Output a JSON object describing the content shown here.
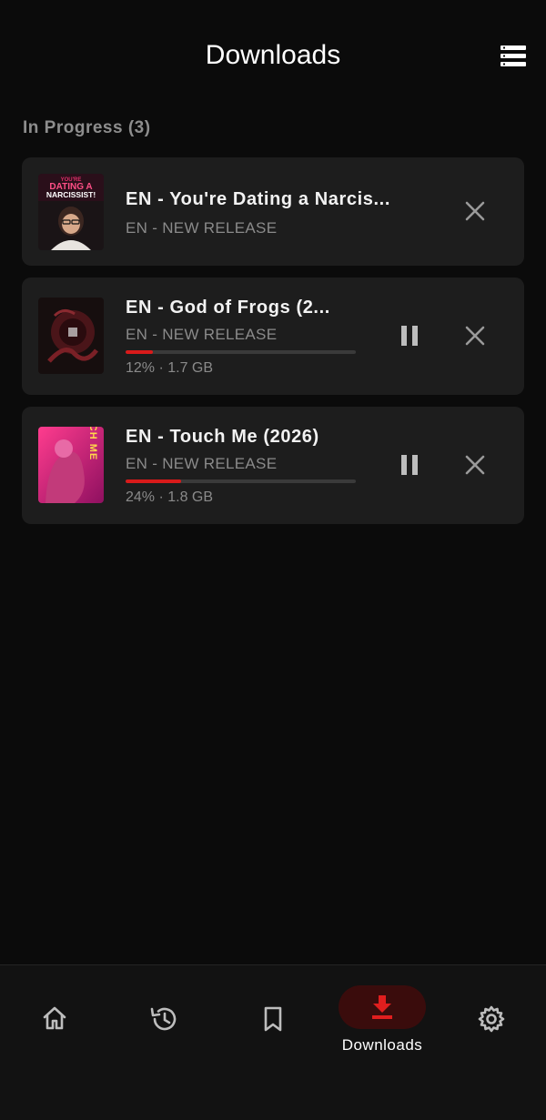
{
  "header": {
    "title": "Downloads"
  },
  "section": {
    "title": "In Progress (3)"
  },
  "items": [
    {
      "title": "EN - You're Dating a Narcis...",
      "subtitle": "EN - NEW RELEASE",
      "thumb_text": [
        "YOU'RE",
        "DATING A",
        "NARCISSIST!"
      ]
    },
    {
      "title": "EN - God of Frogs  (2...",
      "subtitle": "EN - NEW RELEASE",
      "progress": 0.12,
      "meta": "12% · 1.7 GB"
    },
    {
      "title": "EN - Touch Me  (2026)",
      "subtitle": "EN - NEW RELEASE",
      "progress": 0.24,
      "meta": "24% · 1.8 GB",
      "thumb_text": "TOUCH ME"
    }
  ],
  "nav": {
    "items": [
      {
        "icon": "home-icon"
      },
      {
        "icon": "history-icon"
      },
      {
        "icon": "bookmark-icon"
      },
      {
        "icon": "download-icon",
        "label": "Downloads",
        "active": true
      },
      {
        "icon": "gear-icon"
      }
    ]
  },
  "colors": {
    "accent": "#d91a1a",
    "card": "#1d1d1d",
    "background": "#0b0b0b"
  }
}
